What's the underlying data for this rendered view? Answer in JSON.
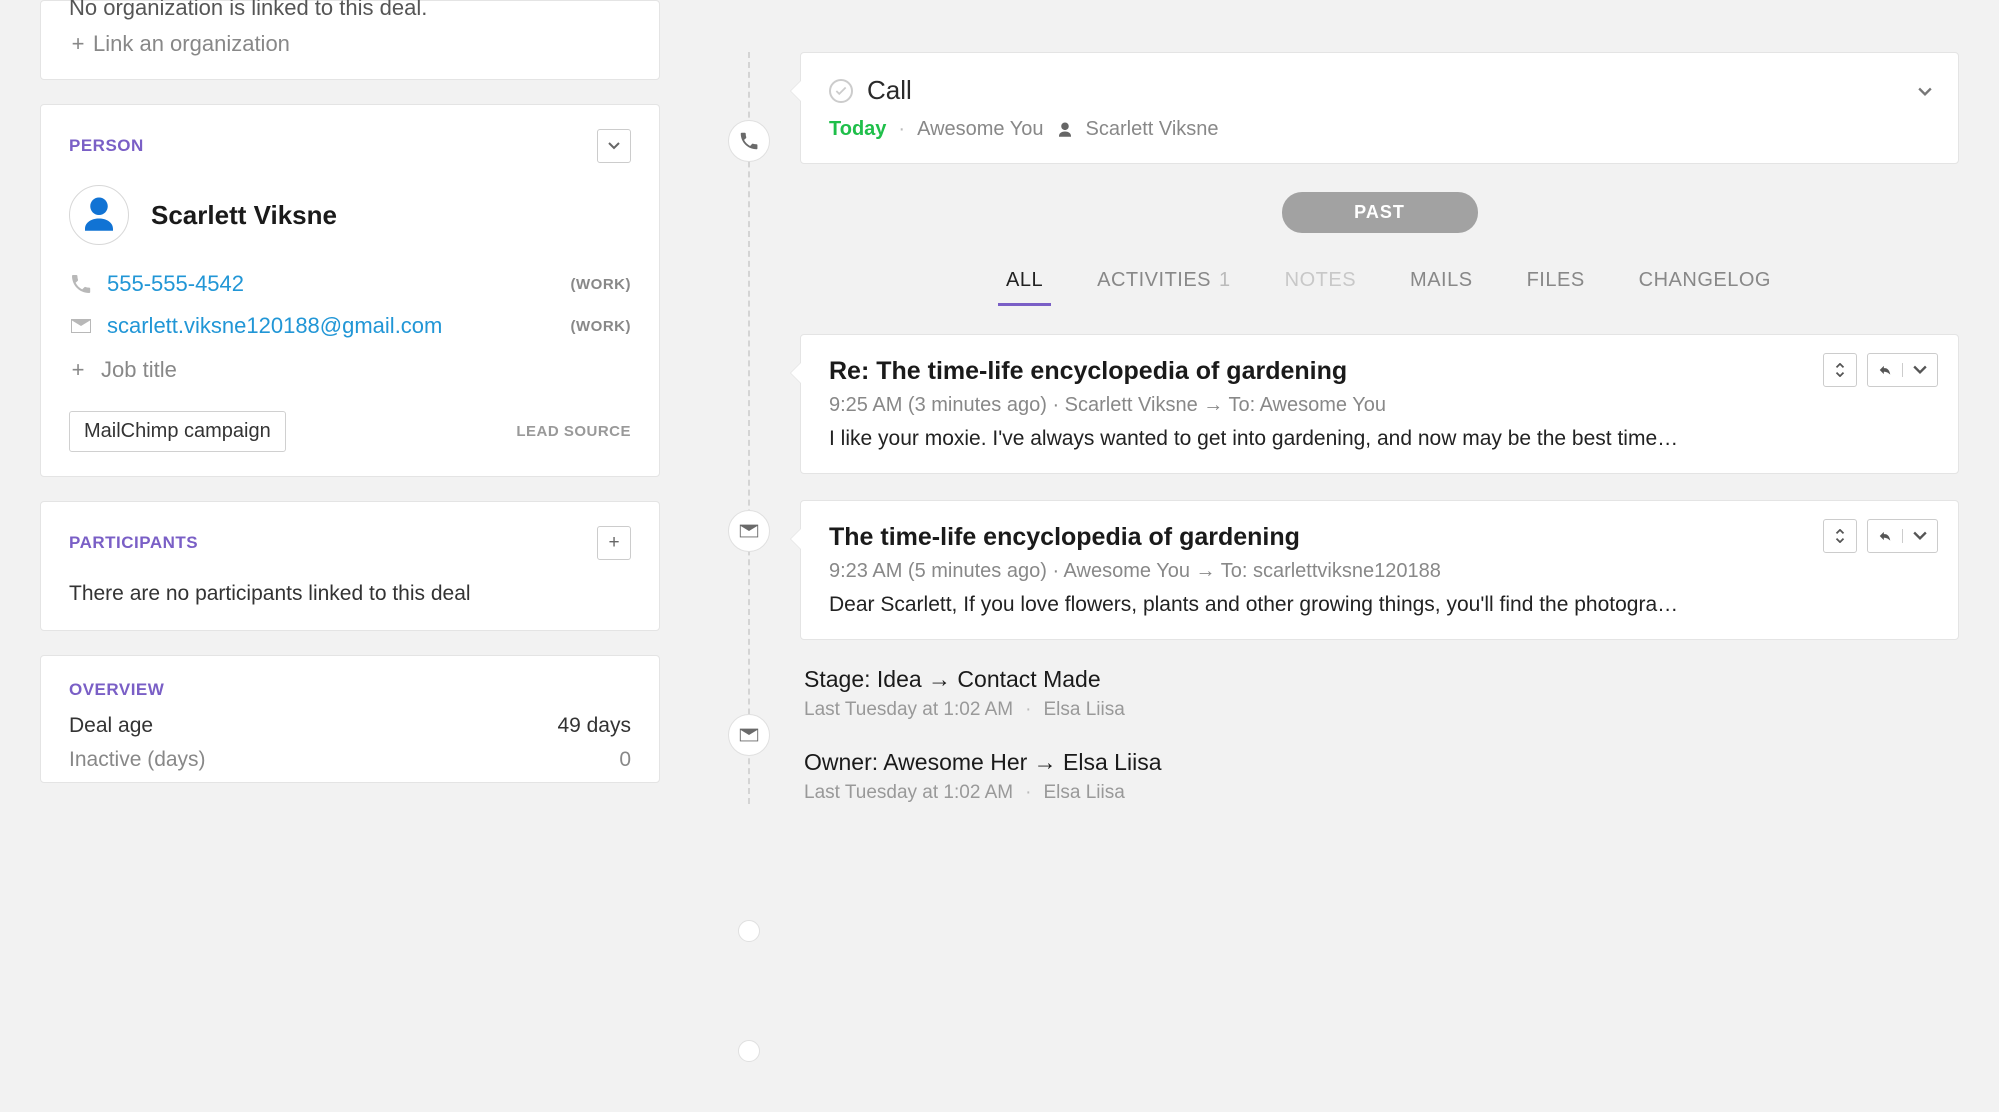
{
  "organization": {
    "empty_text": "No organization is linked to this deal.",
    "link_action": "Link an organization"
  },
  "person": {
    "section_title": "PERSON",
    "name": "Scarlett Viksne",
    "phone": "555-555-4542",
    "phone_label": "(WORK)",
    "email": "scarlett.viksne120188@gmail.com",
    "email_label": "(WORK)",
    "job_title_placeholder": "Job title",
    "lead_source_tag": "MailChimp campaign",
    "lead_source_label": "LEAD SOURCE"
  },
  "participants": {
    "section_title": "PARTICIPANTS",
    "empty_text": "There are no participants linked to this deal"
  },
  "overview": {
    "section_title": "OVERVIEW",
    "rows": [
      {
        "label": "Deal age",
        "value": "49 days"
      },
      {
        "label": "Inactive (days)",
        "value": "0"
      }
    ]
  },
  "activity": {
    "title": "Call",
    "today_label": "Today",
    "owner": "Awesome You",
    "contact": "Scarlett Viksne"
  },
  "past_label": "PAST",
  "tabs": {
    "all": "ALL",
    "activities": "ACTIVITIES",
    "activities_count": "1",
    "notes": "NOTES",
    "mails": "MAILS",
    "files": "FILES",
    "changelog": "CHANGELOG"
  },
  "mails": [
    {
      "subject": "Re: The time-life encyclopedia of gardening",
      "meta": "9:25 AM (3 minutes ago) · Scarlett Viksne → To: Awesome You",
      "preview": "I like your moxie. I've always wanted to get into gardening, and now may be the best time…"
    },
    {
      "subject": "The time-life encyclopedia of gardening",
      "meta": "9:23 AM (5 minutes ago) · Awesome You → To: scarlettviksne120188",
      "preview": "Dear Scarlett, If you love flowers, plants and other growing things, you'll find the photogra…"
    }
  ],
  "changes": [
    {
      "title": "Stage: Idea → Contact Made",
      "time": "Last Tuesday at 1:02 AM",
      "actor": "Elsa Liisa"
    },
    {
      "title": "Owner: Awesome Her → Elsa Liisa",
      "time": "Last Tuesday at 1:02 AM",
      "actor": "Elsa Liisa"
    }
  ]
}
